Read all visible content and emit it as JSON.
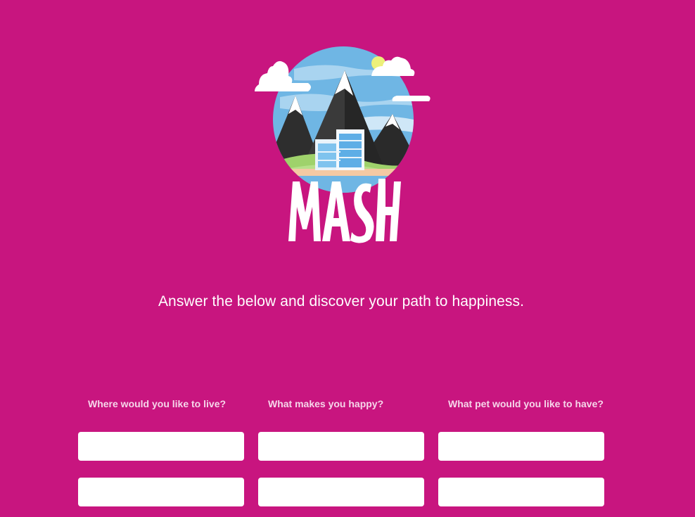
{
  "logo": {
    "wordmark": "MASH"
  },
  "tagline": "Answer the below and discover your path to happiness.",
  "questions": [
    {
      "label": "Where would you like to live?",
      "fields": [
        {
          "value": "",
          "placeholder": ""
        },
        {
          "value": "",
          "placeholder": ""
        }
      ]
    },
    {
      "label": "What makes you happy?",
      "fields": [
        {
          "value": "",
          "placeholder": ""
        },
        {
          "value": "",
          "placeholder": ""
        }
      ]
    },
    {
      "label": "What pet would you like to have?",
      "fields": [
        {
          "value": "",
          "placeholder": ""
        },
        {
          "value": "",
          "placeholder": ""
        }
      ]
    }
  ],
  "colors": {
    "background": "#c8157f",
    "label": "#f6d6ea",
    "field": "#ffffff",
    "sky": "#6fb6e4",
    "mountain": "#333333"
  }
}
